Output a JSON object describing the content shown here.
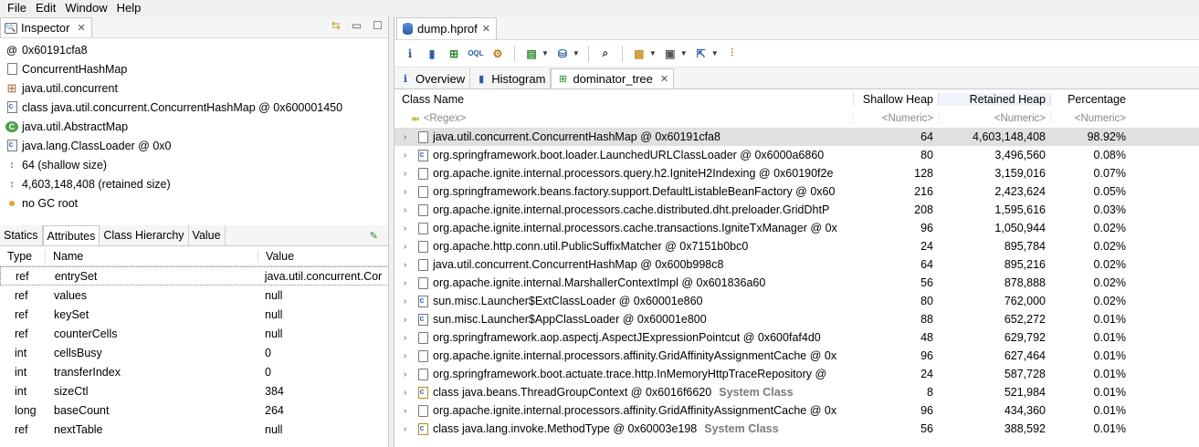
{
  "menubar": [
    "File",
    "Edit",
    "Window",
    "Help"
  ],
  "inspector": {
    "tab_label": "Inspector",
    "rows": [
      {
        "icon": "address-icon",
        "glyph": "@",
        "text": "0x60191cfa8"
      },
      {
        "icon": "document-icon",
        "glyph": "",
        "text": "ConcurrentHashMap"
      },
      {
        "icon": "package-icon",
        "glyph": "⊞",
        "text": "java.util.concurrent"
      },
      {
        "icon": "class-object-icon",
        "glyph": "",
        "text": "class java.util.concurrent.ConcurrentHashMap @ 0x600001450"
      },
      {
        "icon": "superclass-icon",
        "glyph": "C",
        "text": "java.util.AbstractMap"
      },
      {
        "icon": "classloader-icon",
        "glyph": "",
        "text": "java.lang.ClassLoader @ 0x0"
      },
      {
        "icon": "shallow-size-icon",
        "glyph": "↕",
        "text": "64 (shallow size)"
      },
      {
        "icon": "retained-size-icon",
        "glyph": "↕",
        "text": "4,603,148,408 (retained size)"
      },
      {
        "icon": "gc-root-icon",
        "glyph": "",
        "text": "no GC root"
      }
    ],
    "attr_tabs": [
      "Statics",
      "Attributes",
      "Class Hierarchy",
      "Value"
    ],
    "attr_headers": {
      "type": "Type",
      "name": "Name",
      "value": "Value"
    },
    "attributes": [
      {
        "type": "ref",
        "name": "entrySet",
        "value": "java.util.concurrent.Cor"
      },
      {
        "type": "ref",
        "name": "values",
        "value": "null"
      },
      {
        "type": "ref",
        "name": "keySet",
        "value": "null"
      },
      {
        "type": "ref",
        "name": "counterCells",
        "value": "null"
      },
      {
        "type": "int",
        "name": "cellsBusy",
        "value": "0"
      },
      {
        "type": "int",
        "name": "transferIndex",
        "value": "0"
      },
      {
        "type": "int",
        "name": "sizeCtl",
        "value": "384"
      },
      {
        "type": "long",
        "name": "baseCount",
        "value": "264"
      },
      {
        "type": "ref",
        "name": "nextTable",
        "value": "null"
      }
    ]
  },
  "editor": {
    "tab_label": "dump.hprof",
    "sub_tabs": [
      "Overview",
      "Histogram",
      "dominator_tree"
    ],
    "columns": {
      "name": "Class Name",
      "shallow": "Shallow Heap",
      "retained": "Retained Heap",
      "pct": "Percentage"
    },
    "filters": {
      "name": "<Regex>",
      "shallow": "<Numeric>",
      "retained": "<Numeric>",
      "pct": "<Numeric>"
    },
    "rows": [
      {
        "icon": "doc",
        "name": "java.util.concurrent.ConcurrentHashMap @ 0x60191cfa8",
        "sys": "",
        "shallow": "64",
        "retained": "4,603,148,408",
        "pct": "98.92%"
      },
      {
        "icon": "loader",
        "name": "org.springframework.boot.loader.LaunchedURLClassLoader @ 0x6000a6860",
        "sys": "",
        "shallow": "80",
        "retained": "3,496,560",
        "pct": "0.08%"
      },
      {
        "icon": "doc",
        "name": "org.apache.ignite.internal.processors.query.h2.IgniteH2Indexing @ 0x60190f2e",
        "sys": "",
        "shallow": "128",
        "retained": "3,159,016",
        "pct": "0.07%"
      },
      {
        "icon": "doc",
        "name": "org.springframework.beans.factory.support.DefaultListableBeanFactory @ 0x60",
        "sys": "",
        "shallow": "216",
        "retained": "2,423,624",
        "pct": "0.05%"
      },
      {
        "icon": "doc",
        "name": "org.apache.ignite.internal.processors.cache.distributed.dht.preloader.GridDhtP",
        "sys": "",
        "shallow": "208",
        "retained": "1,595,616",
        "pct": "0.03%"
      },
      {
        "icon": "doc",
        "name": "org.apache.ignite.internal.processors.cache.transactions.IgniteTxManager @ 0x",
        "sys": "",
        "shallow": "96",
        "retained": "1,050,944",
        "pct": "0.02%"
      },
      {
        "icon": "doc",
        "name": "org.apache.http.conn.util.PublicSuffixMatcher @ 0x7151b0bc0",
        "sys": "",
        "shallow": "24",
        "retained": "895,784",
        "pct": "0.02%"
      },
      {
        "icon": "doc",
        "name": "java.util.concurrent.ConcurrentHashMap @ 0x600b998c8",
        "sys": "",
        "shallow": "64",
        "retained": "895,216",
        "pct": "0.02%"
      },
      {
        "icon": "doc",
        "name": "org.apache.ignite.internal.MarshallerContextImpl @ 0x601836a60",
        "sys": "",
        "shallow": "56",
        "retained": "878,888",
        "pct": "0.02%"
      },
      {
        "icon": "loader",
        "name": "sun.misc.Launcher$ExtClassLoader @ 0x60001e860",
        "sys": "",
        "shallow": "80",
        "retained": "762,000",
        "pct": "0.02%"
      },
      {
        "icon": "loader",
        "name": "sun.misc.Launcher$AppClassLoader @ 0x60001e800",
        "sys": "",
        "shallow": "88",
        "retained": "652,272",
        "pct": "0.01%"
      },
      {
        "icon": "doc",
        "name": "org.springframework.aop.aspectj.AspectJExpressionPointcut @ 0x600faf4d0",
        "sys": "",
        "shallow": "48",
        "retained": "629,792",
        "pct": "0.01%"
      },
      {
        "icon": "doc",
        "name": "org.apache.ignite.internal.processors.affinity.GridAffinityAssignmentCache @ 0x",
        "sys": "",
        "shallow": "96",
        "retained": "627,464",
        "pct": "0.01%"
      },
      {
        "icon": "doc",
        "name": "org.springframework.boot.actuate.trace.http.InMemoryHttpTraceRepository @",
        "sys": "",
        "shallow": "24",
        "retained": "587,728",
        "pct": "0.01%"
      },
      {
        "icon": "class",
        "name": "class java.beans.ThreadGroupContext @ 0x6016f6620",
        "sys": "System Class",
        "shallow": "8",
        "retained": "521,984",
        "pct": "0.01%"
      },
      {
        "icon": "doc",
        "name": "org.apache.ignite.internal.processors.affinity.GridAffinityAssignmentCache @ 0x",
        "sys": "",
        "shallow": "96",
        "retained": "434,360",
        "pct": "0.01%"
      },
      {
        "icon": "class",
        "name": "class java.lang.invoke.MethodType @ 0x60003e198",
        "sys": "System Class",
        "shallow": "56",
        "retained": "388,592",
        "pct": "0.01%"
      }
    ]
  }
}
